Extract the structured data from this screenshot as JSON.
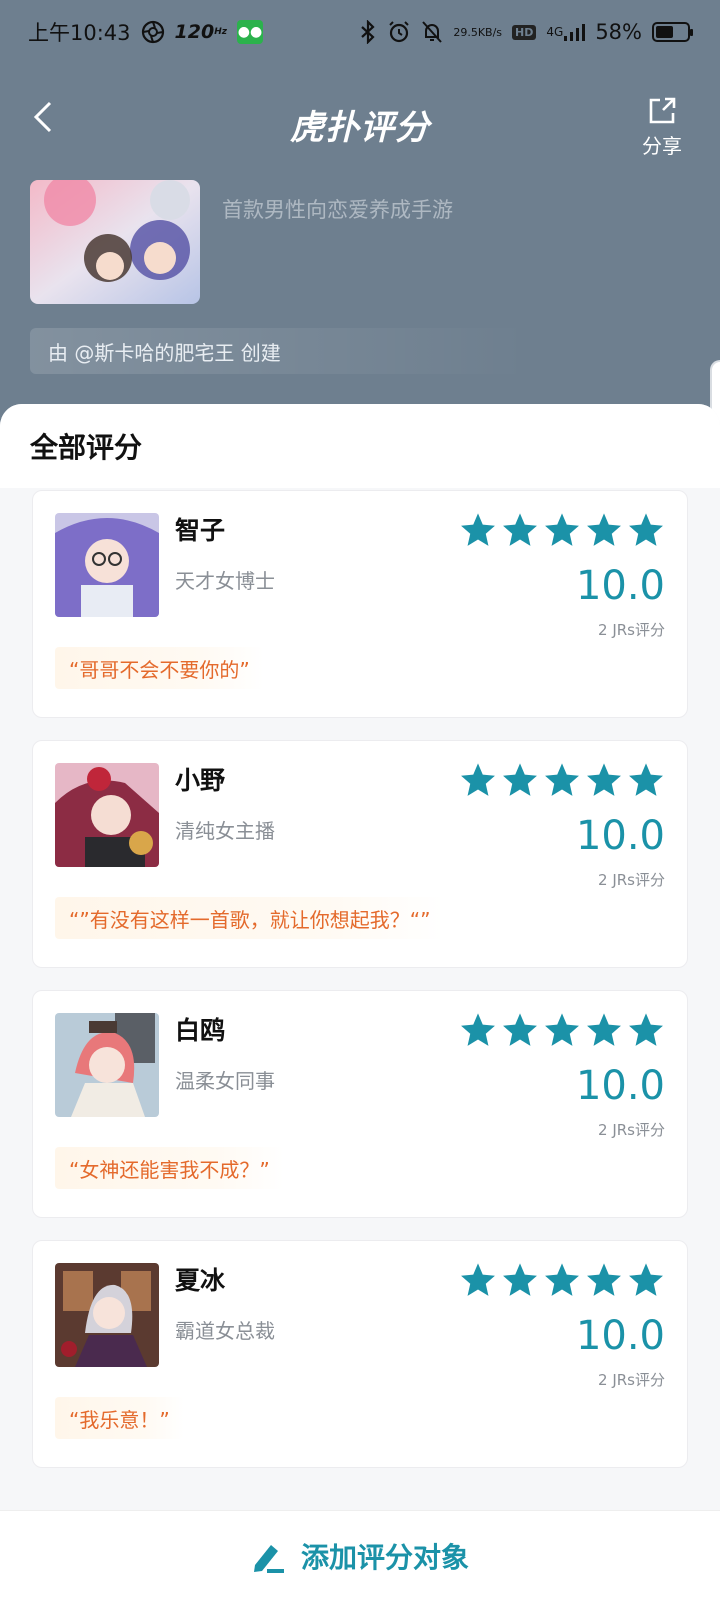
{
  "status_bar": {
    "time": "上午10:43",
    "refresh_rate": "120",
    "refresh_unit": "Hz",
    "net_speed_value": "29.5",
    "net_speed_unit": "KB/s",
    "hd_label": "HD",
    "network": "4G",
    "battery_percent": "58%",
    "battery_level": 0.58
  },
  "header": {
    "logo_text": "虎扑评分",
    "share_label": "分享"
  },
  "intro": {
    "tagline": "首款男性向恋爱养成手游",
    "creator": "由 @斯卡哈的肥宅王 创建"
  },
  "section": {
    "title": "全部评分"
  },
  "items": [
    {
      "name": "智子",
      "role": "天才女博士",
      "score": "10.0",
      "count": "2 JRs评分",
      "quote": "“哥哥不会不要你的”",
      "rating_stars": 5
    },
    {
      "name": "小野",
      "role": "清纯女主播",
      "score": "10.0",
      "count": "2 JRs评分",
      "quote": "“”有没有这样一首歌，就让你想起我？“”",
      "rating_stars": 5
    },
    {
      "name": "白鸥",
      "role": "温柔女同事",
      "score": "10.0",
      "count": "2 JRs评分",
      "quote": "“女神还能害我不成？”",
      "rating_stars": 5
    },
    {
      "name": "夏冰",
      "role": "霸道女总裁",
      "score": "10.0",
      "count": "2 JRs评分",
      "quote": "“我乐意！”",
      "rating_stars": 5
    }
  ],
  "bottom": {
    "add_label": "添加评分对象"
  },
  "colors": {
    "accent": "#1b92a8",
    "header_bg": "#6e7f8f",
    "quote_text": "#e46a2c"
  }
}
